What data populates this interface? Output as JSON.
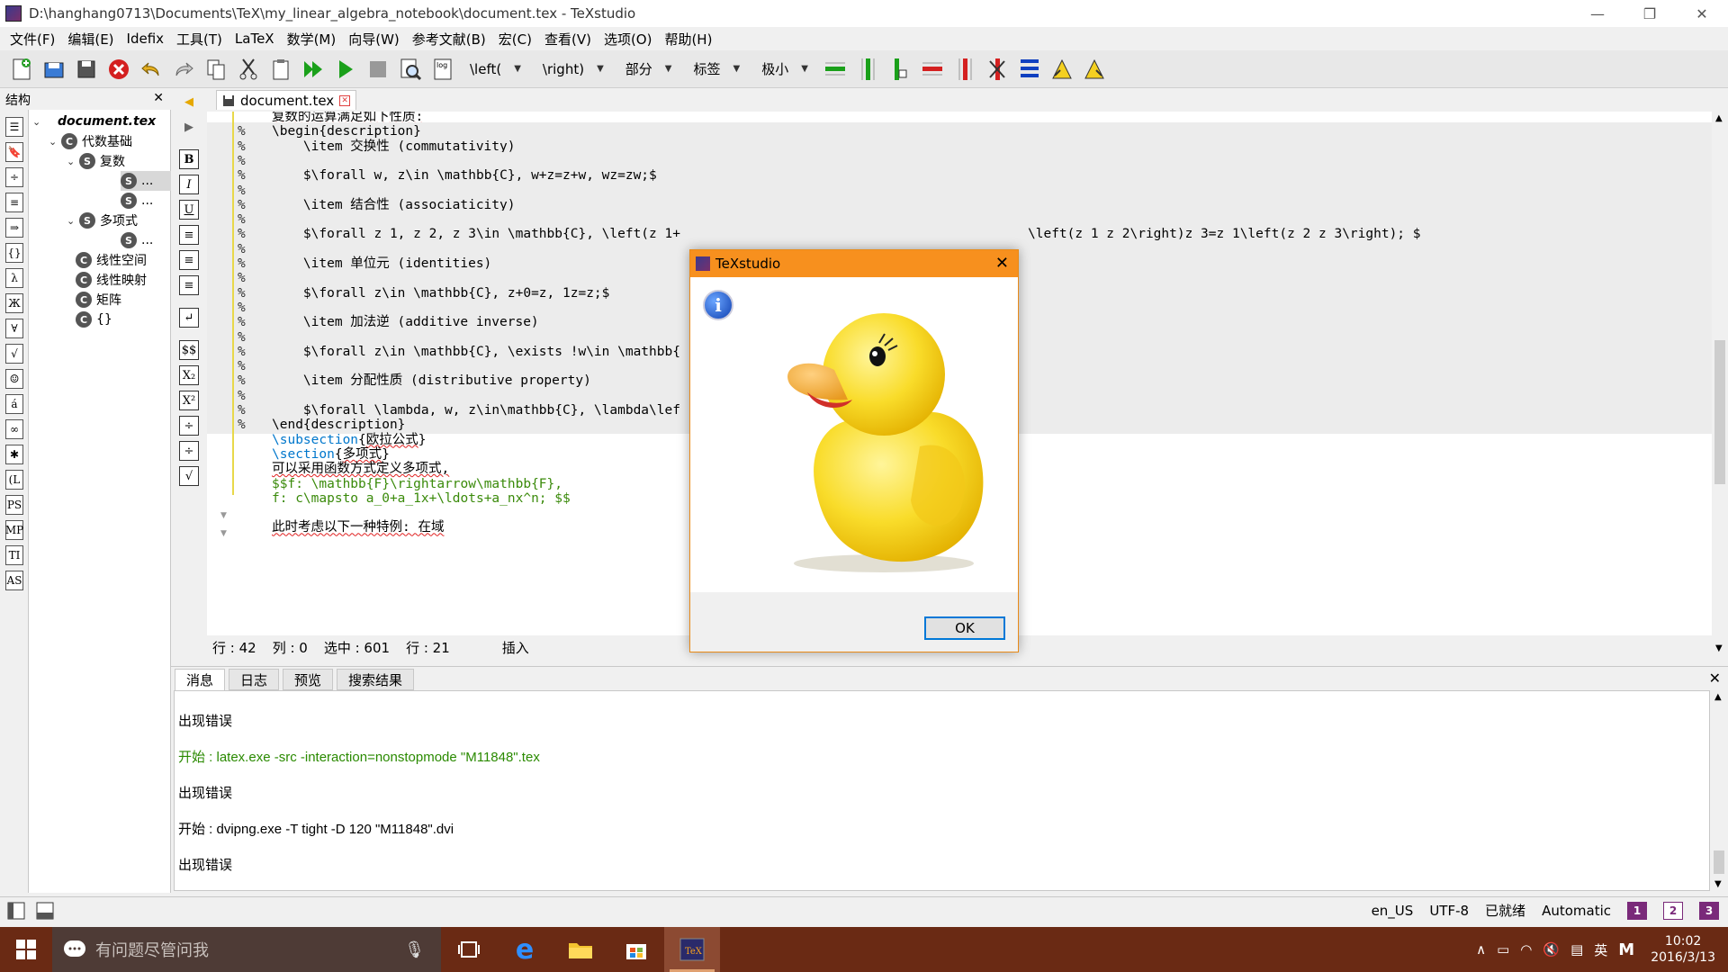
{
  "window": {
    "title": "D:\\hanghang0713\\Documents\\TeX\\my_linear_algebra_notebook\\document.tex - TeXstudio",
    "minimize": "—",
    "maximize": "❐",
    "close": "✕"
  },
  "menu": [
    "文件(F)",
    "编辑(E)",
    "Idefix",
    "工具(T)",
    "LaTeX",
    "数学(M)",
    "向导(W)",
    "参考文献(B)",
    "宏(C)",
    "查看(V)",
    "选项(O)",
    "帮助(H)"
  ],
  "toolbar": {
    "left_delim": "\\left(",
    "right_delim": "\\right)",
    "part": "部分",
    "label": "标签",
    "size": "极小",
    "log_icon_text": "log"
  },
  "structure": {
    "title": "结构",
    "close": "✕",
    "tree": [
      {
        "label": "document.tex",
        "level": 0,
        "italic": true
      },
      {
        "label": "代数基础",
        "level": 1
      },
      {
        "label": "复数",
        "level": 2
      },
      {
        "label": "...",
        "level": 3,
        "selected": true
      },
      {
        "label": "...",
        "level": 3
      },
      {
        "label": "多项式",
        "level": 2
      },
      {
        "label": "...",
        "level": 3
      },
      {
        "label": "线性空间",
        "level": 1
      },
      {
        "label": "线性映射",
        "level": 1
      },
      {
        "label": "矩阵",
        "level": 1
      },
      {
        "label": "{}",
        "level": 1
      }
    ]
  },
  "editor": {
    "tab_label": "document.tex",
    "lines": [
      {
        "pct": "",
        "code": "复数的运算满足如下性质:",
        "style": "squig"
      },
      {
        "pct": "%",
        "code": "\\begin{description}",
        "style": "hl"
      },
      {
        "pct": "%",
        "code": "    \\item 交换性 (commutativity)",
        "style": "hl"
      },
      {
        "pct": "%",
        "code": "",
        "style": "hl"
      },
      {
        "pct": "%",
        "code": "    $\\forall w, z\\in \\mathbb{C}, w+z=z+w, wz=zw;$",
        "style": "hl"
      },
      {
        "pct": "%",
        "code": "",
        "style": "hl"
      },
      {
        "pct": "%",
        "code": "    \\item 结合性 (associaticity)",
        "style": "hl"
      },
      {
        "pct": "%",
        "code": "",
        "style": "hl"
      },
      {
        "pct": "%",
        "code": "    $\\forall z_1, z_2, z_3\\in \\mathbb{C}, \\left(z_1+",
        "style": "hl",
        "tail": "\\left(z_1 z_2\\right)z_3=z_1\\left(z_2 z_3\\right); $"
      },
      {
        "pct": "%",
        "code": "",
        "style": "hl"
      },
      {
        "pct": "%",
        "code": "    \\item 单位元 (identities)",
        "style": "hl"
      },
      {
        "pct": "%",
        "code": "",
        "style": "hl"
      },
      {
        "pct": "%",
        "code": "    $\\forall z\\in \\mathbb{C}, z+0=z, 1z=z;$",
        "style": "hl"
      },
      {
        "pct": "%",
        "code": "",
        "style": "hl"
      },
      {
        "pct": "%",
        "code": "    \\item 加法逆 (additive inverse)",
        "style": "hl"
      },
      {
        "pct": "%",
        "code": "",
        "style": "hl"
      },
      {
        "pct": "%",
        "code": "    $\\forall z\\in \\mathbb{C}, \\exists !w\\in \\mathbb{",
        "style": "hl"
      },
      {
        "pct": "%",
        "code": "",
        "style": "hl"
      },
      {
        "pct": "%",
        "code": "    \\item 分配性质 (distributive property)",
        "style": "hl"
      },
      {
        "pct": "%",
        "code": "",
        "style": "hl"
      },
      {
        "pct": "%",
        "code": "    $\\forall \\lambda, w, z\\in\\mathbb{C}, \\lambda\\lef",
        "style": "hl"
      },
      {
        "pct": "%",
        "code": "\\end{description}",
        "style": "plain"
      },
      {
        "pct": "",
        "code": "\\subsection",
        "arg": "欧拉公式",
        "style": "kw"
      },
      {
        "pct": "",
        "code": "\\section",
        "arg": "多项式",
        "style": "kw"
      },
      {
        "pct": "",
        "code": "可以采用函数方式定义多项式,",
        "style": "squig"
      },
      {
        "pct": "",
        "code": "$$f: \\mathbb{F}\\rightarrow\\mathbb{F},",
        "style": "green"
      },
      {
        "pct": "",
        "code": "f: c\\mapsto a_0+a_1x+\\ldots+a_nx^n; $$",
        "style": "green"
      },
      {
        "pct": "",
        "code": "",
        "style": "plain"
      },
      {
        "pct": "",
        "code": "此时考虑以下一种特例: 在域",
        "style": "squig"
      }
    ],
    "status": {
      "row": "行 : 42",
      "col": "列 : 0",
      "selected": "选中 : 601",
      "lines": "行 : 21",
      "mode": "插入"
    }
  },
  "messages": {
    "tabs": [
      "消息",
      "日志",
      "预览",
      "搜索结果"
    ],
    "close": "✕",
    "lines": [
      {
        "text": "出现错误",
        "color": "#000000"
      },
      {
        "text": "开始 : latex.exe -src -interaction=nonstopmode \"M11848\".tex",
        "color": "#2a8a00"
      },
      {
        "text": "出现错误",
        "color": "#000000"
      },
      {
        "text": "开始 : dvipng.exe -T tight -D 120 \"M11848\".dvi",
        "color": "#000000"
      },
      {
        "text": "出现错误",
        "color": "#000000"
      }
    ]
  },
  "statusbar": {
    "lang": "en_US",
    "encoding": "UTF-8",
    "state": "已就绪",
    "mode": "Automatic",
    "bookmarks": [
      "1",
      "2",
      "3"
    ]
  },
  "dialog": {
    "title": "TeXstudio",
    "close": "✕",
    "info_glyph": "i",
    "ok": "OK"
  },
  "taskbar": {
    "search_placeholder": "有问题尽管问我",
    "ime": "英",
    "ime2": "M",
    "time": "10:02",
    "date": "2016/3/13"
  },
  "colors": {
    "dialog_title": "#f7901e",
    "taskbar": "#6a2a14",
    "keyword": "#0077cc",
    "math_green": "#3a8a0a"
  }
}
